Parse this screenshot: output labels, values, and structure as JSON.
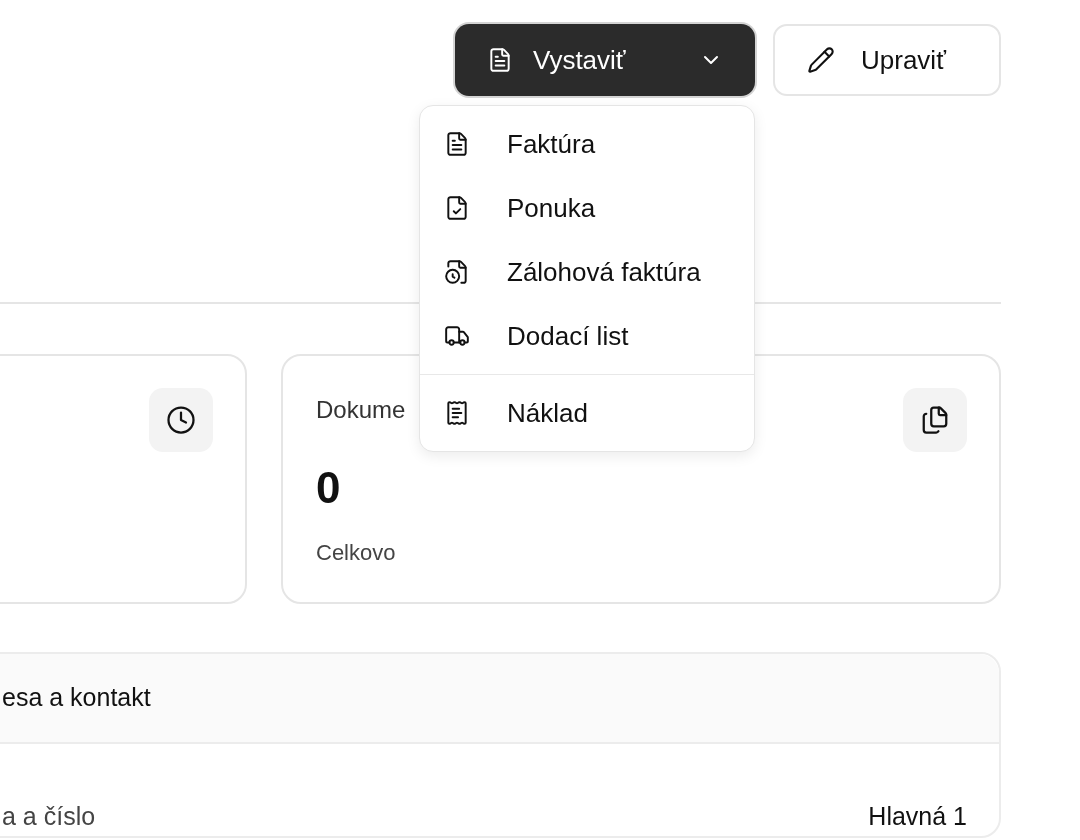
{
  "actions": [
    {
      "label": "Vystaviť",
      "kind": "dropdown",
      "expanded": true
    },
    {
      "label": "Upraviť",
      "kind": "edit"
    }
  ],
  "menu": {
    "groups": [
      [
        {
          "label": "Faktúra",
          "kind": "invoice"
        },
        {
          "label": "Ponuka",
          "kind": "offer"
        },
        {
          "label": "Zálohová faktúra",
          "kind": "advance"
        },
        {
          "label": "Dodací list",
          "kind": "delivery"
        }
      ],
      [
        {
          "label": "Náklad",
          "kind": "expense"
        }
      ]
    ]
  },
  "cards": [
    {
      "kind": "clock"
    },
    {
      "title": "Dokume",
      "value": "0",
      "caption": "Celkovo",
      "kind": "documents"
    }
  ],
  "address_panel": {
    "title": "esa a kontakt",
    "rows": [
      {
        "label": "a a číslo",
        "value": "Hlavná 1"
      }
    ]
  }
}
